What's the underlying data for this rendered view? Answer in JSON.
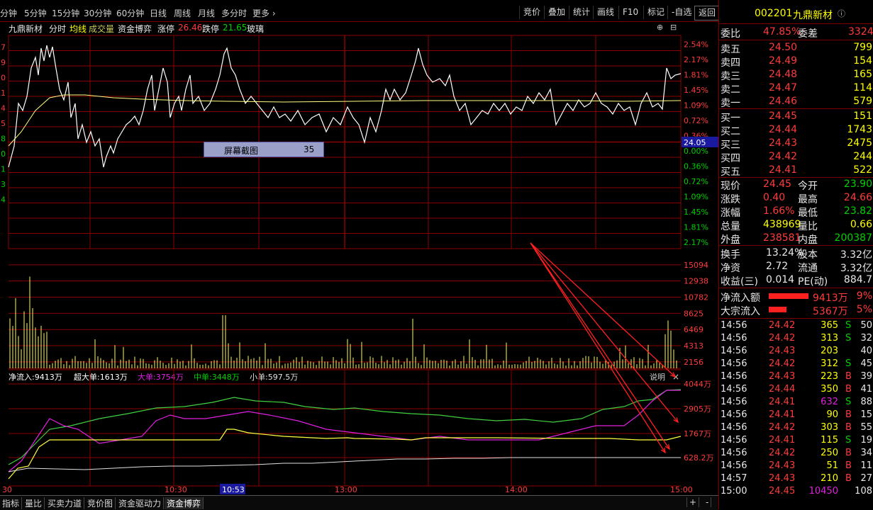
{
  "toolbar": {
    "periods": [
      "分钟",
      "5分钟",
      "15分钟",
      "30分钟",
      "60分钟",
      "日线",
      "周线",
      "月线",
      "多分时",
      "更多"
    ],
    "more_arrow": "›",
    "buttons": [
      "竞价",
      "叠加",
      "统计",
      "画线",
      "F10",
      "标记",
      "-自选",
      "返回"
    ]
  },
  "stock": {
    "code": "002201",
    "name": "九鼎新材",
    "info_tag": "ⓘ"
  },
  "info_line": {
    "name": "九鼎新材",
    "tab_fenshi": "分时",
    "tab_junxian": "均线",
    "tab_volume": "成交量",
    "tab_fund": "资金博弈",
    "limit_up_label": "涨停",
    "limit_up_value": "26.46",
    "limit_down_label": "跌停",
    "limit_down_value": "21.65",
    "sector": "玻璃"
  },
  "popup": {
    "label": "屏幕截图",
    "value": "35"
  },
  "price_axis": {
    "labels": [
      "2.54%",
      "2.17%",
      "1.81%",
      "1.45%",
      "1.09%",
      "0.72%",
      "0.36%",
      "0.00%",
      "0.36%",
      "0.72%",
      "1.09%",
      "1.45%",
      "1.81%",
      "2.17%"
    ],
    "current_price": "24.05",
    "left_cut_labels": [
      "7",
      "9",
      "0",
      "1",
      "4",
      "5",
      "8",
      "0",
      "1",
      "3",
      "4"
    ]
  },
  "volume_axis": {
    "labels": [
      "15094",
      "12938",
      "10782",
      "8625",
      "6469",
      "4313",
      "2156"
    ]
  },
  "fund_legend": {
    "net": "净流入:9413万",
    "super": "超大单:1613万",
    "large": "大单:3754万",
    "mid": "中单:3448万",
    "small": "小单:597.5万",
    "explain": "说明",
    "close": "×"
  },
  "fund_axis": {
    "labels": [
      "4044万",
      "2905万",
      "1767万",
      "628.2万"
    ]
  },
  "time_axis": {
    "labels": [
      "30",
      "10:30",
      "10:53",
      "13:00",
      "14:00",
      "15:00"
    ]
  },
  "bottom_tabs": [
    "指标",
    "量比",
    "买卖力道",
    "竞价图",
    "资金驱动力",
    "资金博弈"
  ],
  "bottom_right": {
    "plus": "+",
    "minus": "-"
  },
  "orderbook": {
    "weibi_label": "委比",
    "weibi_value": "47.85%",
    "weicha_label": "委差",
    "weicha_value": "3324",
    "asks": [
      {
        "label": "卖五",
        "price": "24.50",
        "vol": "799"
      },
      {
        "label": "卖四",
        "price": "24.49",
        "vol": "154"
      },
      {
        "label": "卖三",
        "price": "24.48",
        "vol": "165"
      },
      {
        "label": "卖二",
        "price": "24.47",
        "vol": "114"
      },
      {
        "label": "卖一",
        "price": "24.46",
        "vol": "579"
      }
    ],
    "bids": [
      {
        "label": "买一",
        "price": "24.45",
        "vol": "151"
      },
      {
        "label": "买二",
        "price": "24.44",
        "vol": "1743"
      },
      {
        "label": "买三",
        "price": "24.43",
        "vol": "2475"
      },
      {
        "label": "买四",
        "price": "24.42",
        "vol": "244"
      },
      {
        "label": "买五",
        "price": "24.41",
        "vol": "522"
      }
    ]
  },
  "quote": [
    {
      "l1": "现价",
      "v1": "24.45",
      "c1": "red",
      "l2": "今开",
      "v2": "23.90",
      "c2": "green"
    },
    {
      "l1": "涨跌",
      "v1": "0.40",
      "c1": "red",
      "l2": "最高",
      "v2": "24.66",
      "c2": "red"
    },
    {
      "l1": "涨幅",
      "v1": "1.66%",
      "c1": "red",
      "l2": "最低",
      "v2": "23.82",
      "c2": "green"
    },
    {
      "l1": "总量",
      "v1": "438969",
      "c1": "yellow",
      "l2": "量比",
      "v2": "0.66",
      "c2": "yellow"
    },
    {
      "l1": "外盘",
      "v1": "238581",
      "c1": "red",
      "l2": "内盘",
      "v2": "200387",
      "c2": "green"
    }
  ],
  "stats": [
    {
      "l1": "换手",
      "v1": "13.24%",
      "l2": "股本",
      "v2": "3.32亿"
    },
    {
      "l1": "净资",
      "v1": "2.72",
      "l2": "流通",
      "v2": "3.32亿"
    },
    {
      "l1": "收益(三)",
      "v1": "0.014",
      "l2": "PE(动)",
      "v2": "884.7"
    }
  ],
  "flows": [
    {
      "label": "净流入额",
      "value": "9413万",
      "pct": "9%",
      "bar": 0.8
    },
    {
      "label": "大宗流入",
      "value": "5367万",
      "pct": "5%",
      "bar": 0.35
    }
  ],
  "ticks": [
    {
      "t": "14:56",
      "p": "24.42",
      "v": "365",
      "s": "S",
      "n": "50"
    },
    {
      "t": "14:56",
      "p": "24.42",
      "v": "313",
      "s": "S",
      "n": "32"
    },
    {
      "t": "14:56",
      "p": "24.43",
      "v": "203",
      "s": "",
      "n": "40"
    },
    {
      "t": "14:56",
      "p": "24.42",
      "v": "312",
      "s": "S",
      "n": "45"
    },
    {
      "t": "14:56",
      "p": "24.43",
      "v": "223",
      "s": "B",
      "n": "39"
    },
    {
      "t": "14:56",
      "p": "24.44",
      "v": "350",
      "s": "B",
      "n": "41"
    },
    {
      "t": "14:56",
      "p": "24.41",
      "v": "632",
      "s": "S",
      "n": "88"
    },
    {
      "t": "14:56",
      "p": "24.41",
      "v": "90",
      "s": "B",
      "n": "15"
    },
    {
      "t": "14:56",
      "p": "24.42",
      "v": "303",
      "s": "B",
      "n": "55"
    },
    {
      "t": "14:56",
      "p": "24.41",
      "v": "115",
      "s": "S",
      "n": "19"
    },
    {
      "t": "14:56",
      "p": "24.42",
      "v": "250",
      "s": "B",
      "n": "34"
    },
    {
      "t": "14:56",
      "p": "24.43",
      "v": "51",
      "s": "B",
      "n": "11"
    },
    {
      "t": "14:57",
      "p": "24.43",
      "v": "210",
      "s": "B",
      "n": "27"
    },
    {
      "t": "15:00",
      "p": "24.45",
      "v": "10450",
      "s": "",
      "n": "108"
    }
  ],
  "colors": {
    "up": "#ff3b3b",
    "down": "#00d000",
    "grid": "#8b0000",
    "price_line": "#ffffff",
    "avg_line": "#ffff80"
  }
}
